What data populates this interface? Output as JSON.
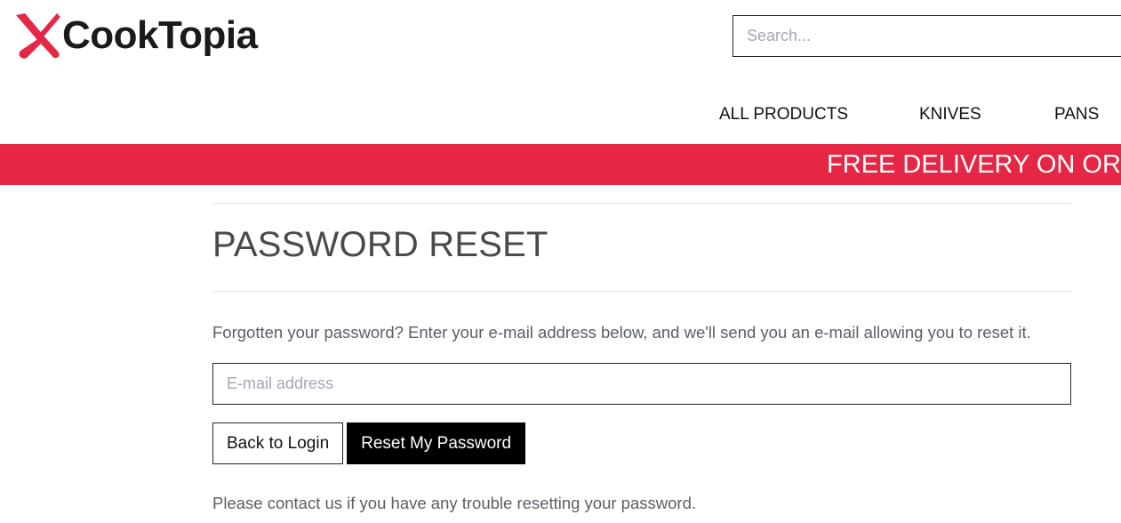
{
  "brand": {
    "name": "CookTopia",
    "icon": "crossed-knives-icon",
    "accent_color": "#e52645"
  },
  "search": {
    "placeholder": "Search..."
  },
  "nav": {
    "items": [
      {
        "label": "ALL PRODUCTS"
      },
      {
        "label": "KNIVES"
      },
      {
        "label": "PANS"
      }
    ]
  },
  "banner": {
    "text": "FREE DELIVERY ON ORD"
  },
  "main": {
    "title": "PASSWORD RESET",
    "intro": "Forgotten your password? Enter your e-mail address below, and we'll send you an e-mail allowing you to reset it.",
    "email_placeholder": "E-mail address",
    "email_value": "",
    "back_button": "Back to Login",
    "reset_button": "Reset My Password",
    "help_text": "Please contact us if you have any trouble resetting your password."
  }
}
